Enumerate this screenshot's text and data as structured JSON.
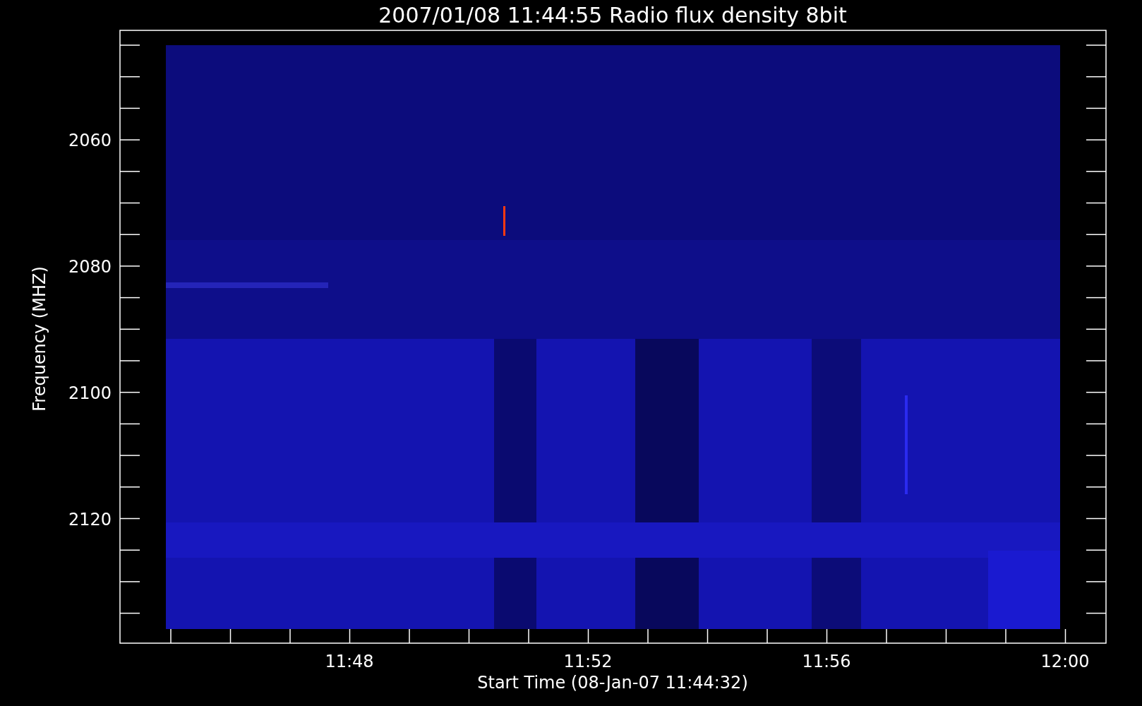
{
  "title": "2007/01/08 11:44:55 Radio flux density 8bit",
  "y_axis": {
    "label": "Frequency (MHZ)",
    "ticks": [
      "2060",
      "2080",
      "2100",
      "2120"
    ]
  },
  "x_axis": {
    "label": "Start Time (08-Jan-07 11:44:32)",
    "ticks": [
      "11:48",
      "11:52",
      "11:56",
      "12:00"
    ]
  }
}
